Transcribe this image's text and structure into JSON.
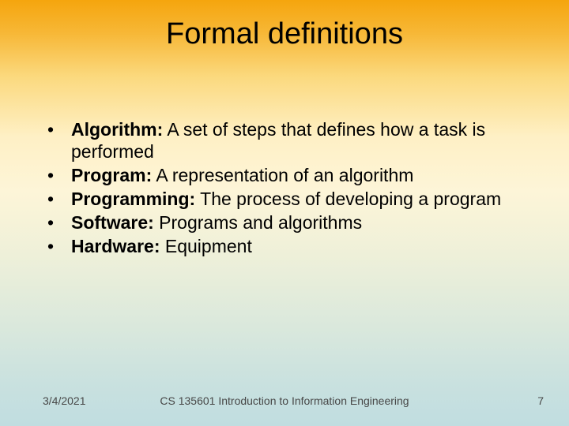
{
  "title": "Formal definitions",
  "bullet_char": "•",
  "items": [
    {
      "term": "Algorithm:",
      "def": " A set of steps that defines how a task is performed"
    },
    {
      "term": "Program:",
      "def": " A representation of an algorithm"
    },
    {
      "term": "Programming:",
      "def": " The process of developing a program"
    },
    {
      "term": "Software:",
      "def": " Programs and algorithms"
    },
    {
      "term": "Hardware:",
      "def": " Equipment"
    }
  ],
  "footer": {
    "date": "3/4/2021",
    "center": "CS 135601 Introduction to Information Engineering",
    "page": "7"
  }
}
